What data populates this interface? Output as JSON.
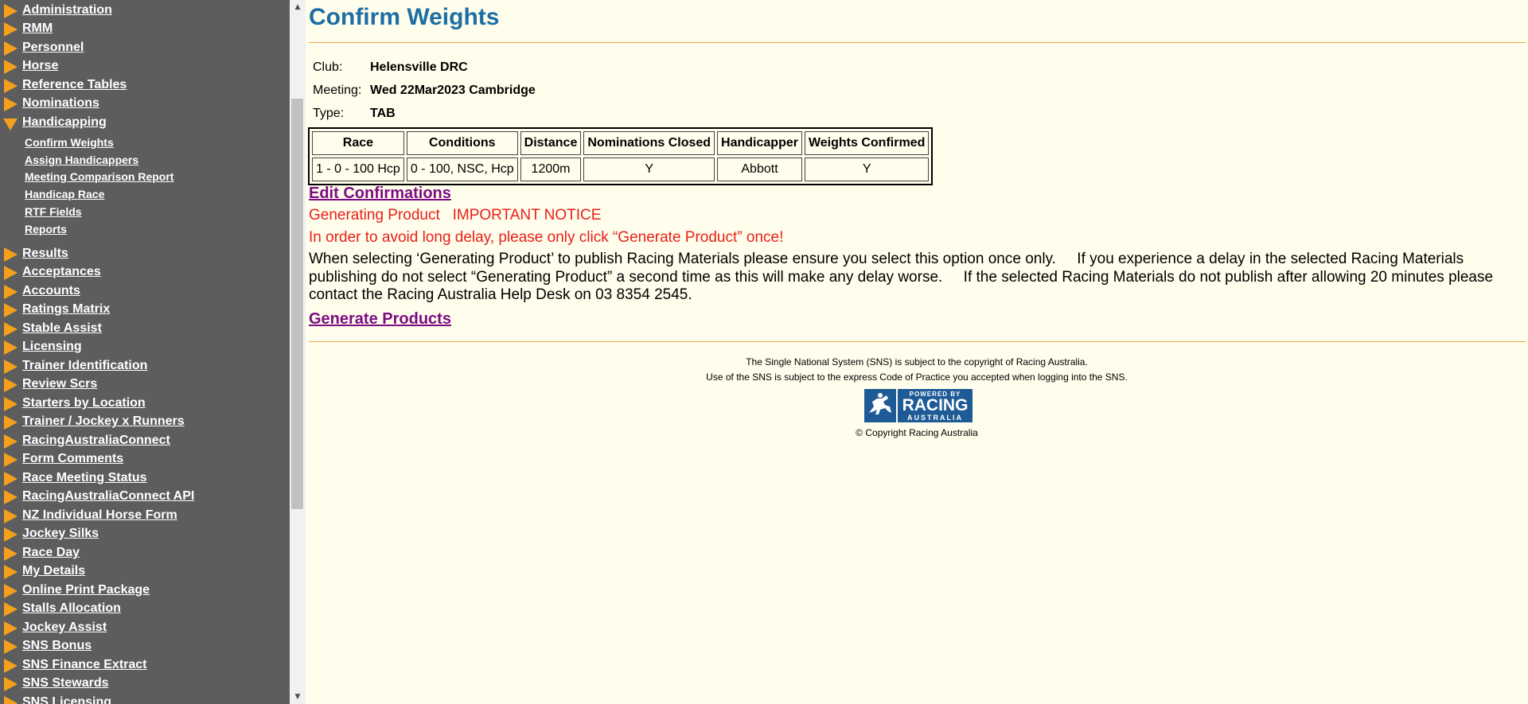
{
  "sidebar": {
    "items": [
      {
        "label": "Administration"
      },
      {
        "label": "RMM"
      },
      {
        "label": "Personnel"
      },
      {
        "label": "Horse"
      },
      {
        "label": "Reference Tables"
      },
      {
        "label": "Nominations"
      },
      {
        "label": "Handicapping",
        "expanded": true
      },
      {
        "label": "Results"
      },
      {
        "label": "Acceptances"
      },
      {
        "label": "Accounts"
      },
      {
        "label": "Ratings Matrix"
      },
      {
        "label": "Stable Assist"
      },
      {
        "label": "Licensing"
      },
      {
        "label": "Trainer Identification"
      },
      {
        "label": "Review Scrs"
      },
      {
        "label": "Starters by Location"
      },
      {
        "label": "Trainer / Jockey x Runners"
      },
      {
        "label": "RacingAustraliaConnect"
      },
      {
        "label": "Form Comments"
      },
      {
        "label": "Race Meeting Status"
      },
      {
        "label": "RacingAustraliaConnect API"
      },
      {
        "label": "NZ Individual Horse Form"
      },
      {
        "label": "Jockey Silks"
      },
      {
        "label": "Race Day"
      },
      {
        "label": "My Details"
      },
      {
        "label": "Online Print Package"
      },
      {
        "label": "Stalls Allocation"
      },
      {
        "label": "Jockey Assist"
      },
      {
        "label": "SNS Bonus"
      },
      {
        "label": "SNS Finance Extract"
      },
      {
        "label": "SNS Stewards"
      },
      {
        "label": "SNS Licensing"
      }
    ],
    "handicapping_sub": [
      {
        "label": "Confirm Weights"
      },
      {
        "label": "Assign Handicappers"
      },
      {
        "label": "Meeting Comparison Report"
      },
      {
        "label": "Handicap Race"
      },
      {
        "label": "RTF Fields"
      },
      {
        "label": "Reports"
      }
    ]
  },
  "page": {
    "title": "Confirm Weights",
    "club_label": "Club:",
    "club_value": "Helensville DRC",
    "meeting_label": "Meeting:",
    "meeting_value": "Wed 22Mar2023 Cambridge",
    "type_label": "Type:",
    "type_value": "TAB"
  },
  "table": {
    "headers": [
      "Race",
      "Conditions",
      "Distance",
      "Nominations Closed",
      "Handicapper",
      "Weights Confirmed"
    ],
    "rows": [
      [
        "1 - 0 - 100 Hcp",
        "0 - 100, NSC, Hcp",
        "1200m",
        "Y",
        "Abbott",
        "Y"
      ]
    ]
  },
  "actions": {
    "edit_confirmations": "Edit Confirmations",
    "generate_products": "Generate Products"
  },
  "notice": {
    "heading": "Generating Product   IMPORTANT NOTICE",
    "warning": "In order to avoid long delay, please only click “Generate Product” once!",
    "body": "When selecting ‘Generating Product’ to publish Racing Materials please ensure you select this option once only.     If you experience a delay in the selected Racing Materials publishing do not select “Generating Product” a second time as this will make any delay worse.     If the selected Racing Materials do not publish after allowing 20 minutes please contact the Racing Australia Help Desk on 03 8354 2545."
  },
  "footer": {
    "line1": "The Single National System (SNS) is subject to the copyright of Racing Australia.",
    "line2": "Use of the SNS is subject to the express Code of Practice you accepted when logging into the SNS.",
    "logo_top": "POWERED BY",
    "logo_main": "RACING",
    "logo_sub": "AUSTRALIA",
    "copyright": "© Copyright Racing Australia"
  },
  "colors": {
    "sidebar_bg": "#5d5d5d",
    "page_bg": "#fffdeb",
    "title": "#1c6ea4",
    "accent_arrow": "#f4a01c",
    "link_visited": "#7b0c84",
    "notice_red": "#e8201c",
    "logo_blue": "#1e5b96"
  }
}
